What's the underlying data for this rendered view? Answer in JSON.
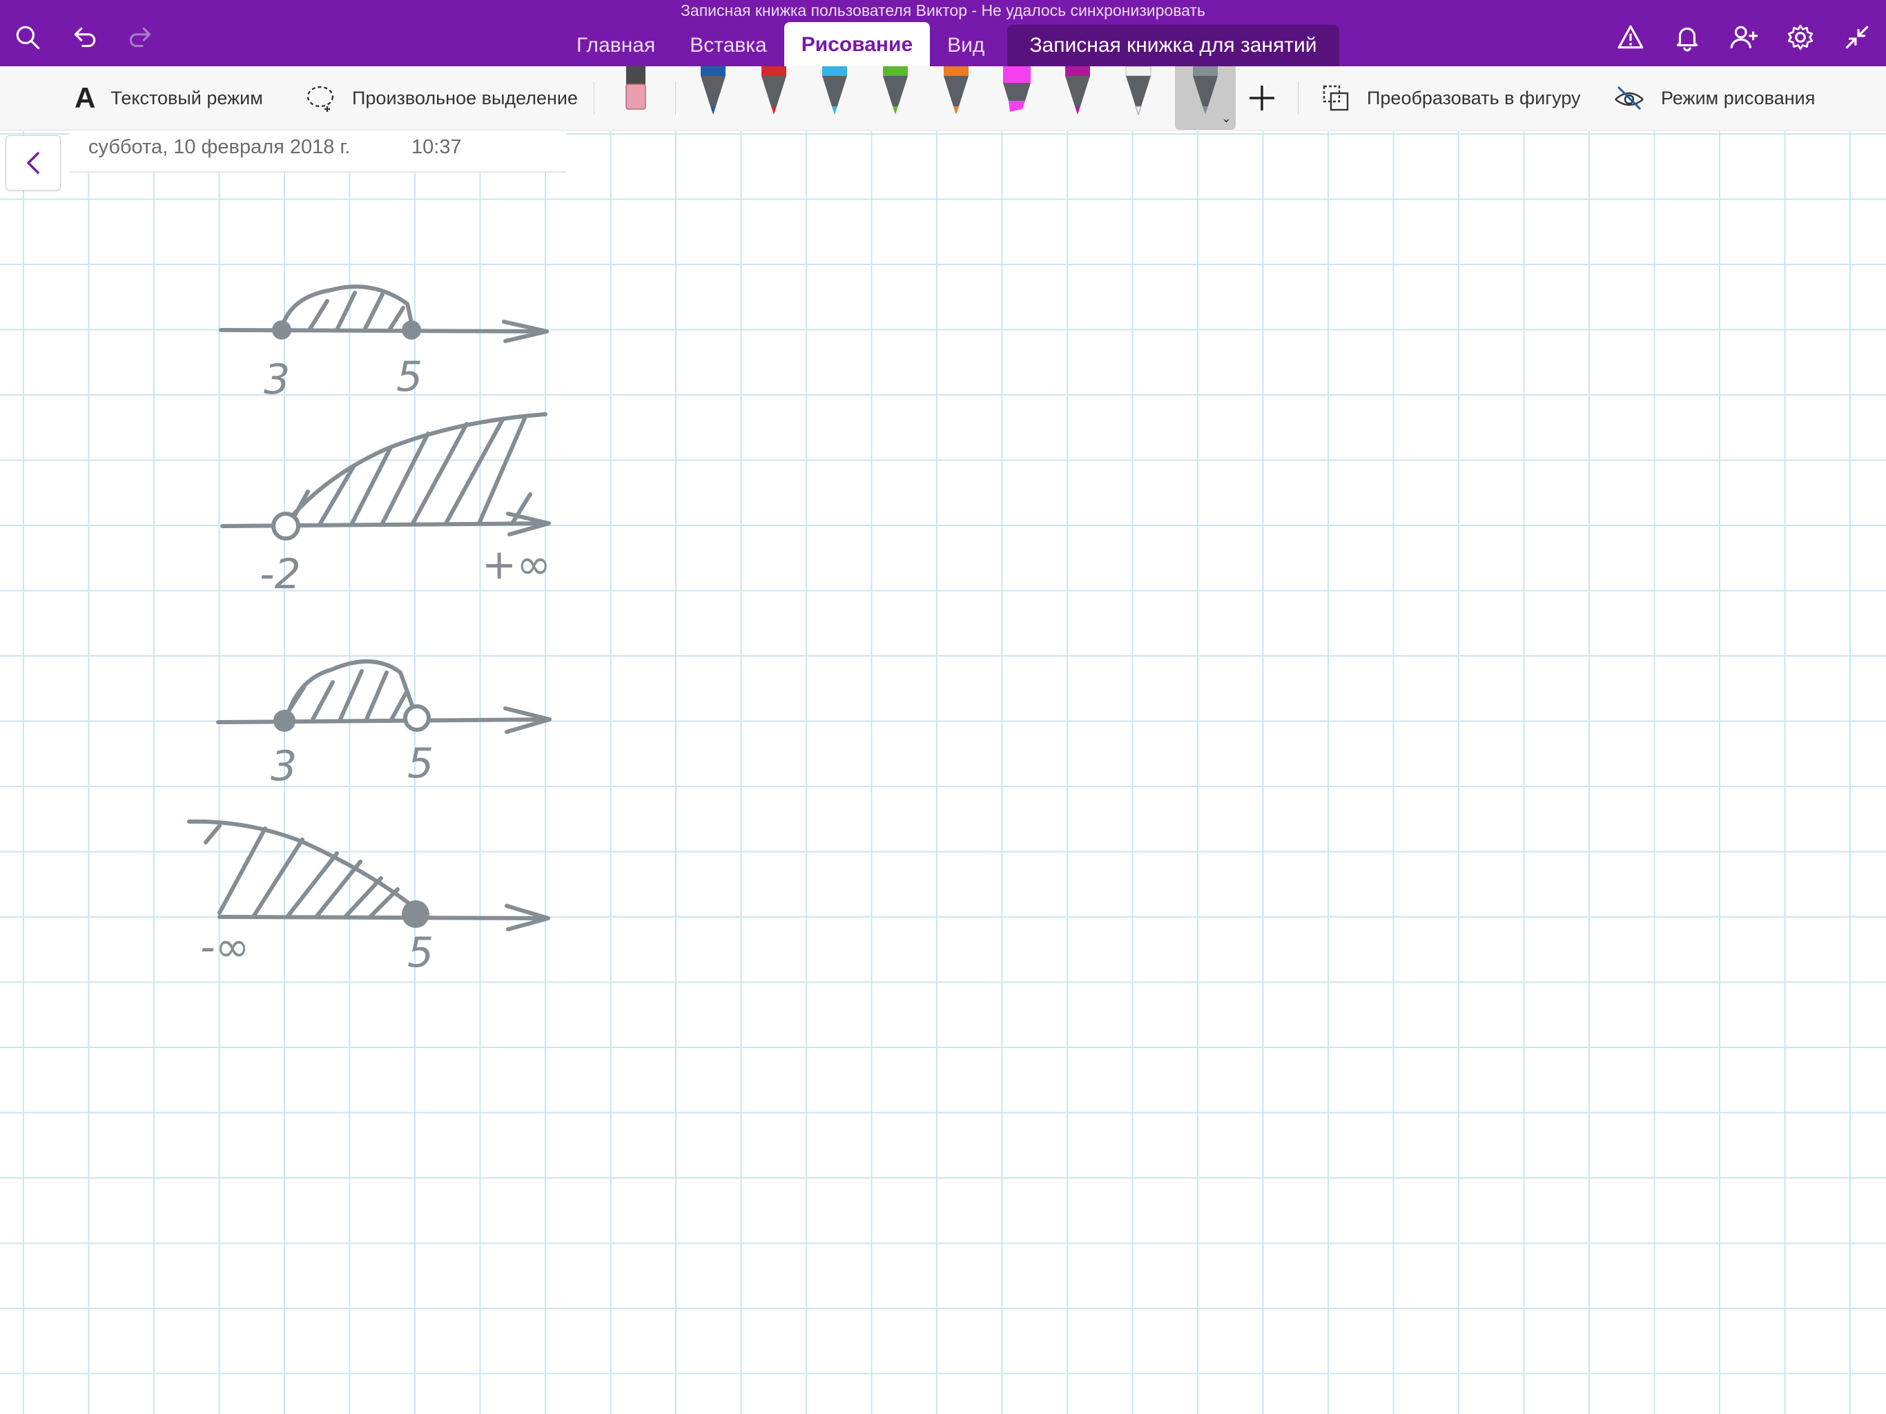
{
  "window": {
    "title": "Записная книжка пользователя Виктор - Не удалось синхронизировать"
  },
  "toolbar_left": {
    "icons": [
      "search-icon",
      "undo-icon",
      "redo-icon"
    ]
  },
  "tabs": [
    {
      "label": "Главная",
      "active": false
    },
    {
      "label": "Вставка",
      "active": false
    },
    {
      "label": "Рисование",
      "active": true
    },
    {
      "label": "Вид",
      "active": false
    },
    {
      "label": "Записная книжка для занятий",
      "active": false
    }
  ],
  "toolbar_right": {
    "icons": [
      "warning-icon",
      "bell-icon",
      "add-user-icon",
      "gear-icon",
      "collapse-icon"
    ]
  },
  "ribbon": {
    "text_mode_label": "Текстовый режим",
    "lasso_label": "Произвольное выделение",
    "convert_label": "Преобразовать в фигуру",
    "draw_mode_label": "Режим рисования",
    "pens": [
      {
        "name": "eraser",
        "color": "#e8a0b0"
      },
      {
        "name": "pen-blue",
        "color": "#1b5ea8"
      },
      {
        "name": "pen-red",
        "color": "#d42a2a"
      },
      {
        "name": "pen-cyan",
        "color": "#34b3e4"
      },
      {
        "name": "pen-green",
        "color": "#5cb82c"
      },
      {
        "name": "pen-orange",
        "color": "#ee7a22"
      },
      {
        "name": "highlighter-magenta",
        "color": "#f640f0"
      },
      {
        "name": "pen-purple",
        "color": "#b0189c"
      },
      {
        "name": "pen-white",
        "color": "#f2f2f2"
      },
      {
        "name": "pen-gray",
        "color": "#848d94",
        "selected": true
      }
    ]
  },
  "page": {
    "date": "суббота, 10 февраля 2018 г.",
    "time": "10:37"
  },
  "ink_labels": {
    "l1_a": "3",
    "l1_b": "5",
    "l2_a": "-2",
    "l2_b": "+∞",
    "l3_a": "3",
    "l3_b": "5",
    "l4_a": "-∞",
    "l4_b": "5"
  },
  "colors": {
    "brand_purple": "#7719aa",
    "notebook_tab": "#58127e",
    "ink_gray": "#848d94",
    "grid_line": "#cbe6ee"
  }
}
